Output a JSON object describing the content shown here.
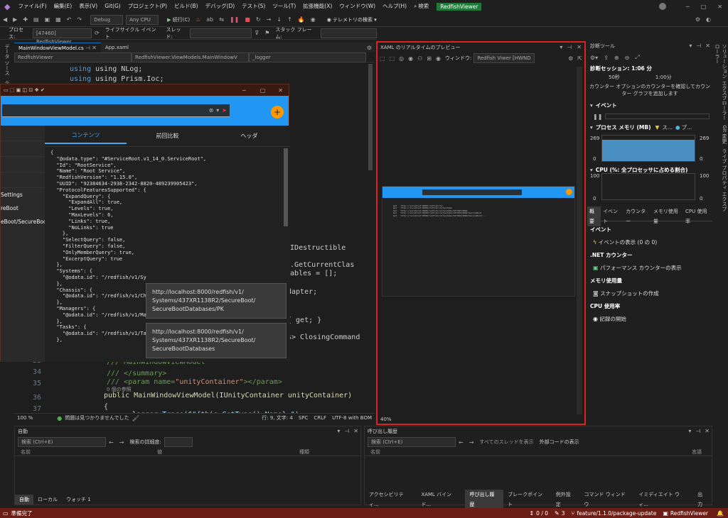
{
  "menubar": {
    "items": [
      "ファイル(F)",
      "編集(E)",
      "表示(V)",
      "Git(G)",
      "プロジェクト(P)",
      "ビルド(B)",
      "デバッグ(D)",
      "テスト(S)",
      "ツール(T)",
      "拡張機能(X)",
      "ウィンドウ(W)",
      "ヘルプ(H)"
    ],
    "search": "検索",
    "badge": "RedfishViewer"
  },
  "toolbar": {
    "config": "Debug",
    "platform": "Any CPU",
    "continue": "続行(C)",
    "telemetry": "テレメトリの検索"
  },
  "procbar": {
    "process_label": "プロセス:",
    "process": "[47460] RedfishViewer",
    "lifecycle": "ライフサイクル イベント",
    "thread_label": "スレッド:",
    "stack_label": "スタック フレーム:"
  },
  "editor": {
    "tabs": [
      "MainWindowViewModel.cs",
      "App.xaml"
    ],
    "nav1": "RedfishViewer",
    "nav2": "RedfishViewer.ViewModels.MainWindowV",
    "nav3": "_logger",
    "zoom": "100 %",
    "issues": "問題は見つかりませんでした",
    "pos": "行: 9, 文字: 4",
    "spc": "SPC",
    "crlf": "CRLF",
    "enc": "UTF-8 with BOM"
  },
  "code": {
    "l1": "using NLog;",
    "l2": "using Prism.Ioc;",
    "f1": ", IDestructible",
    "f2": "er.GetCurrentClas",
    "f3": "osables = [];",
    "f4": "dapter;",
    "f5": "{ get; }",
    "f6": "s> ClosingCommand",
    "c34": "/// MainWindowViewModel",
    "c35": "/// </summary>",
    "c36a": "/// <param name=",
    "c36b": "\"unityContainer\"",
    "c36c": "></param>",
    "refs": "0 個の参照",
    "ctor": "public MainWindowViewModel(IUnityContainer unityContainer)",
    "brace": "{",
    "last": "_logger.Trace($\"{this.GetType().Name} \");",
    "n33": "33",
    "n34": "34",
    "n35": "35",
    "n36": "36",
    "n37": "37"
  },
  "app": {
    "tabs": [
      "コンテンツ",
      "前回比較",
      "ヘッダ"
    ],
    "side": [
      "Settings",
      "reBoot",
      "eBoot/SecureBoo"
    ],
    "json": "{\n  \"@odata.type\": \"#ServiceRoot.v1_14_0.ServiceRoot\",\n  \"Id\": \"RootService\",\n  \"Name\": \"Root Service\",\n  \"RedfishVersion\": \"1.15.0\",\n  \"UUID\": \"92384634-2938-2342-8820-489239905423\",\n  \"ProtocolFeaturesSupported\": {\n    \"ExpandQuery\": {\n      \"ExpandAll\": true,\n      \"Levels\": true,\n      \"MaxLevels\": 6,\n      \"Links\": true,\n      \"NoLinks\": true\n    },\n    \"SelectQuery\": false,\n    \"FilterQuery\": false,\n    \"OnlyMemberQuery\": true,\n    \"ExcerptQuery\": true\n  },\n  \"Systems\": {\n    \"@odata.id\": \"/redfish/v1/Sy\n  },\n  \"Chassis\": {\n    \"@odata.id\": \"/redfish/v1/Ch\n  },\n  \"Managers\": {\n    \"@odata.id\": \"/redfish/v1/Ma\n  },\n  \"Tasks\": {\n    \"@odata.id\": \"/redfish/v1/Ta\n  },",
    "tip1": "http://localhost:8000/redfish/v1/\nSystems/437XR1138R2/SecureBoot/\nSecureBootDatabases/PK",
    "tip2": "http://localhost:8000/redfish/v1/\nSystems/437XR1138R2/SecureBoot/\nSecureBootDatabases"
  },
  "xaml": {
    "title": "XAML のリアルタイムのプレビュー",
    "window_label": "ウィンドウ:",
    "window": "Redfish Viwer [HWND",
    "zoom": "40%"
  },
  "diag": {
    "title": "診断ツール",
    "session": "診断セッション: 1:06 分",
    "t1": "50秒",
    "t2": "1:00分",
    "counter_note": "カウンター オプションのカウンターを確認してカウンター グラフを追加します",
    "events": "イベント",
    "mem": "プロセス メモリ (MB)",
    "mem_legend": "ス...",
    "mem_legend2": "プ...",
    "mem_max": "269",
    "mem_min": "0",
    "cpu": "CPU (%: 全プロセッサに占める割合)",
    "cpu_max": "100",
    "cpu_min": "0",
    "tabs": [
      "概要",
      "イベント",
      "カウンター",
      "メモリ使用量",
      "CPU 使用率"
    ],
    "s_events": "イベント",
    "s_events_item": "イベントの表示 (0 の 0)",
    "s_net": ".NET カウンター",
    "s_net_item": "パフォーマンス カウンターの表示",
    "s_mem": "メモリ使用量",
    "s_mem_item": "スナップショットの作成",
    "s_cpu": "CPU 使用率",
    "s_cpu_item": "記録の開始"
  },
  "rightvbar": "ソリューション エクスプローラー　Git 変更　ライブ プロパティ エクスプローラー",
  "leftvbar": "データ ソース　テスト エクスプローラー",
  "autos": {
    "title": "自動",
    "search": "検索 (Ctrl+E)",
    "depth": "検索の詳細度:",
    "cols": [
      "名前",
      "値",
      "種類"
    ],
    "tabs": [
      "自動",
      "ローカル",
      "ウォッチ 1"
    ]
  },
  "calls": {
    "title": "呼び出し履歴",
    "search": "検索 (Ctrl+E)",
    "threads": "すべてのスレッドを表示",
    "external": "外部コードの表示",
    "cols": [
      "名前",
      "言語"
    ],
    "tabs": [
      "アクセシビリティ...",
      "XAML バインド...",
      "呼び出し履歴",
      "ブレークポイント",
      "例外設定",
      "コマンド ウィンドウ",
      "イミディエイト ウィ...",
      "出力"
    ]
  },
  "status": {
    "ready": "準備完了",
    "updown": "0 / 0",
    "pencil": "3",
    "branch": "feature/1.1.0/package-update",
    "repo": "RedfishViewer"
  },
  "colors": {
    "accent": "#0e70c0",
    "status": "#6b1e16",
    "highlight": "#e02020",
    "app_header": "#2196f3",
    "fab": "#ff9800"
  }
}
